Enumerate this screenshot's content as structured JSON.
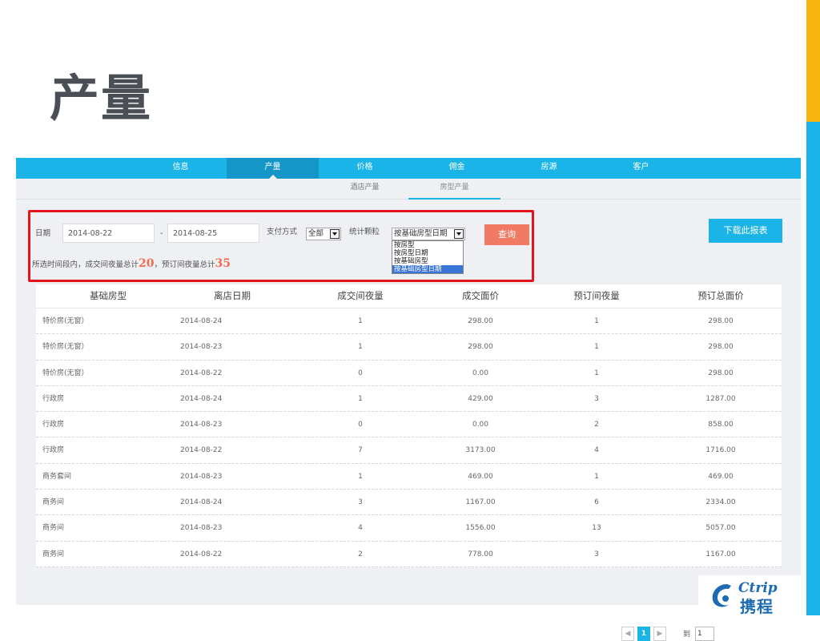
{
  "page": {
    "title": "产量"
  },
  "colors": {
    "accent_blue": "#1ab4e8",
    "accent_yellow": "#f7b512",
    "query_button": "#f07a64",
    "highlight_red": "#e3141b",
    "logo_blue": "#1d6cb3"
  },
  "topnav": {
    "items": [
      {
        "label": "信息",
        "active": false
      },
      {
        "label": "产量",
        "active": true
      },
      {
        "label": "价格",
        "active": false
      },
      {
        "label": "佣金",
        "active": false
      },
      {
        "label": "房源",
        "active": false
      },
      {
        "label": "客户",
        "active": false
      }
    ]
  },
  "subnav": {
    "items": [
      {
        "label": "酒店产量",
        "active": false
      },
      {
        "label": "房型产量",
        "active": true
      }
    ]
  },
  "filter": {
    "date_label": "日期",
    "date_from": "2014-08-22",
    "date_sep": "-",
    "date_to": "2014-08-25",
    "pay_label": "支付方式",
    "pay_value": "全部",
    "stat_label": "统计颗粒",
    "stat_value": "按基础房型日期",
    "stat_options": [
      "按房型",
      "按房型日期",
      "按基础房型",
      "按基础房型日期"
    ],
    "query_label": "查询",
    "download_label": "下载此报表"
  },
  "summary": {
    "prefix": "所选时间段内，成交间夜量总计",
    "deal_total": "20",
    "middle": "，预订间夜量总计",
    "booked_total": "35"
  },
  "table": {
    "headers": [
      "基础房型",
      "离店日期",
      "成交间夜量",
      "成交面价",
      "预订间夜量",
      "预订总面价"
    ],
    "rows": [
      [
        "特价房(无窗）",
        "2014-08-24",
        "1",
        "298.00",
        "1",
        "298.00"
      ],
      [
        "特价房(无窗）",
        "2014-08-23",
        "1",
        "298.00",
        "1",
        "298.00"
      ],
      [
        "特价房(无窗）",
        "2014-08-22",
        "0",
        "0.00",
        "1",
        "298.00"
      ],
      [
        "行政房",
        "2014-08-24",
        "1",
        "429.00",
        "3",
        "1287.00"
      ],
      [
        "行政房",
        "2014-08-23",
        "0",
        "0.00",
        "2",
        "858.00"
      ],
      [
        "行政房",
        "2014-08-22",
        "7",
        "3173.00",
        "4",
        "1716.00"
      ],
      [
        "商务套间",
        "2014-08-23",
        "1",
        "469.00",
        "1",
        "469.00"
      ],
      [
        "商务间",
        "2014-08-24",
        "3",
        "1167.00",
        "6",
        "2334.00"
      ],
      [
        "商务间",
        "2014-08-23",
        "4",
        "1556.00",
        "13",
        "5057.00"
      ],
      [
        "商务间",
        "2014-08-22",
        "2",
        "778.00",
        "3",
        "1167.00"
      ]
    ]
  },
  "pager": {
    "prev": "◀",
    "current": "1",
    "next": "▶",
    "goto_label": "到",
    "goto_value": "1"
  },
  "logo": {
    "en": "Ctrip",
    "zh": "携程"
  }
}
